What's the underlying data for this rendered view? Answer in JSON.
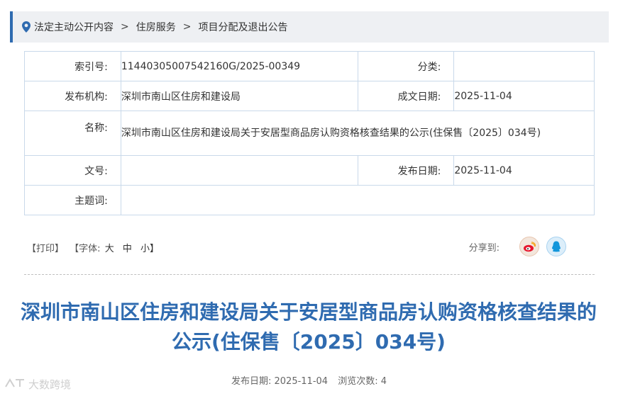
{
  "breadcrumb": {
    "items": [
      "法定主动公开内容",
      "住房服务",
      "项目分配及退出公告"
    ],
    "separator": ">"
  },
  "meta": {
    "index_label": "索引号:",
    "index_value": "11440305007542160G/2025-00349",
    "category_label": "分类:",
    "category_value": "",
    "publisher_label": "发布机构:",
    "publisher_value": "深圳市南山区住房和建设局",
    "created_label": "成文日期:",
    "created_value": "2025-11-04",
    "name_label": "名称:",
    "name_value": "深圳市南山区住房和建设局关于安居型商品房认购资格核查结果的公示(住保售〔2025〕034号)",
    "docno_label": "文号:",
    "docno_value": "",
    "published_label": "发布日期:",
    "published_value": "2025-11-04",
    "keywords_label": "主题词:",
    "keywords_value": ""
  },
  "toolbar": {
    "print": "【打印】",
    "font_prefix": "【字体:",
    "font_large": "大",
    "font_medium": "中",
    "font_small": "小】",
    "share_label": "分享到:"
  },
  "article": {
    "title": "深圳市南山区住房和建设局关于安居型商品房认购资格核查结果的公示(住保售〔2025〕034号)",
    "info_date_label": "发布日期:",
    "info_date": "2025-11-04",
    "views_label": "浏览次数:",
    "views": "4"
  },
  "watermark": "大数跨境",
  "colors": {
    "accent": "#2f6bb0",
    "border": "#c9d9ea",
    "crumb_bg": "#eef0f3",
    "weibo": "#e6162d",
    "qq": "#1296db"
  },
  "icons": [
    "location-pin-icon",
    "weibo-icon",
    "qq-icon"
  ]
}
